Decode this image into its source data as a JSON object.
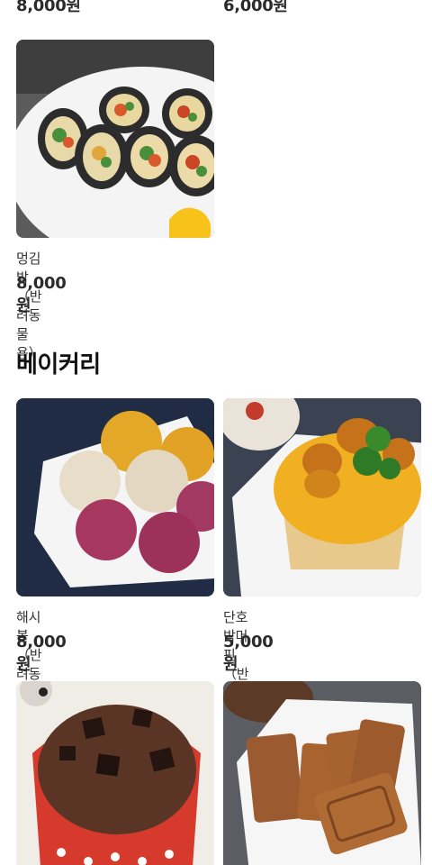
{
  "top_row": {
    "left_price": "8,000원",
    "right_price": "6,000원"
  },
  "prev_section": {
    "items": [
      {
        "name": "멍김밥 （반려동물용）",
        "price": "8,000원",
        "image": "black-seaweed-kimbap-photo"
      }
    ]
  },
  "bakery_section": {
    "title": "베이커리",
    "items": [
      {
        "name": "해시볼 （반려동물용）",
        "price": "8,000원",
        "image": "coated-rice-balls-photo"
      },
      {
        "name": "단호박머핀（반려동물용）",
        "price": "5,000원",
        "image": "pumpkin-muffin-photo"
      },
      {
        "name": "",
        "price": "",
        "image": "chocolate-cup-muffin-photo"
      },
      {
        "name": "",
        "price": "",
        "image": "biscoff-style-cookies-photo"
      }
    ]
  }
}
